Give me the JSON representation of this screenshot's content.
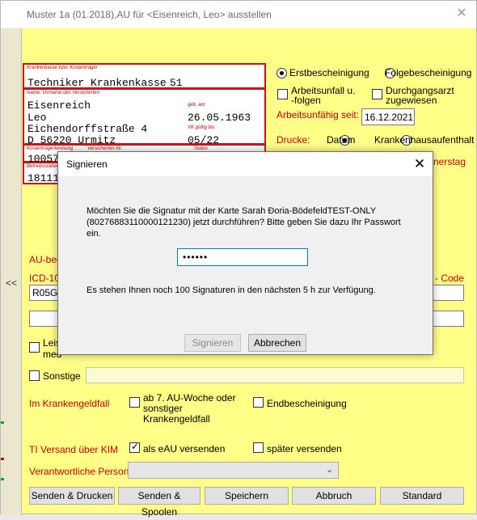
{
  "window": {
    "title": "Muster 1a (01.2018),AU für <Eisenreich, Leo> ausstellen",
    "close_glyph": "✕",
    "collapse_glyph": "<<"
  },
  "card": {
    "kasse_label": "Krankenkasse bzw. Kostenträger",
    "kasse_value": "Techniker Krankenkasse",
    "kasse_num": "51",
    "name_label": "Name, Vorname des Versicherten",
    "last_name": "Eisenreich",
    "first_name": "Leo",
    "street": "Eichendorffstraße 4",
    "city": "D 56220 Urmitz",
    "dob_label": "geb. am",
    "dob": "26.05.1963",
    "vk_label": "VK gültig bis",
    "vk": "05/22",
    "kt_label": "Kostenträgerkennung",
    "vnr_label": "Versicherten-Nr.",
    "status_label": "Status",
    "kt_value": "100571",
    "bs_label": "Betriebsstätten-Nr.",
    "bs_value": "181111"
  },
  "options": {
    "erst": "Erstbescheinigung",
    "folge": "Folgebescheinigung",
    "unfall": "Arbeitsunfall u. -folgen",
    "durchgang": "Durchgangsarzt zugewiesen",
    "au_seit_label": "Arbeitsunfähig seit:",
    "au_seit_value": "16.12.2021",
    "drucke_label": "Drucke:",
    "datum": "Datum",
    "kh": "Krankenhausaufenthalt",
    "partial_right": "nerstag"
  },
  "lower": {
    "au_beg": "AU-beg",
    "icd": "ICD-10",
    "code": "- Code",
    "icd_value": "R05G",
    "leist": "Leist",
    "med": "med",
    "sonstige": "Sonstige",
    "kgfall": "Im Krankengeldfall",
    "ab7": "ab 7. AU-Woche oder sonstiger Krankengeldfall",
    "endb": "Endbescheinigung",
    "ti": "TI Versand über KIM",
    "eau": "als eAU versenden",
    "spaeter": "später versenden",
    "person": "Verantwortliche Person"
  },
  "buttons": {
    "senden_drucken": "Senden & Drucken",
    "senden_spoolen": "Senden & Spoolen",
    "speichern": "Speichern",
    "abbruch": "Abbruch",
    "standard": "Standard"
  },
  "dialog": {
    "title": "Signieren",
    "close_glyph": "✕",
    "message": "Möchten Sie die Signatur mit der Karte Sarah Ðoria-BödefeldTEST-ONLY (80276883110000121230) jetzt durchführen? Bitte geben Sie dazu Ihr Passwort ein.",
    "password_mask": "••••••",
    "info": "Es stehen Ihnen noch 100 Signaturen in den nächsten 5 h zur Verfügung.",
    "sign_label": "Signieren",
    "cancel_label": "Abbrechen"
  },
  "colors": {
    "form_bg": "#ffff88",
    "red": "#c00000",
    "card_border": "#d01010"
  }
}
